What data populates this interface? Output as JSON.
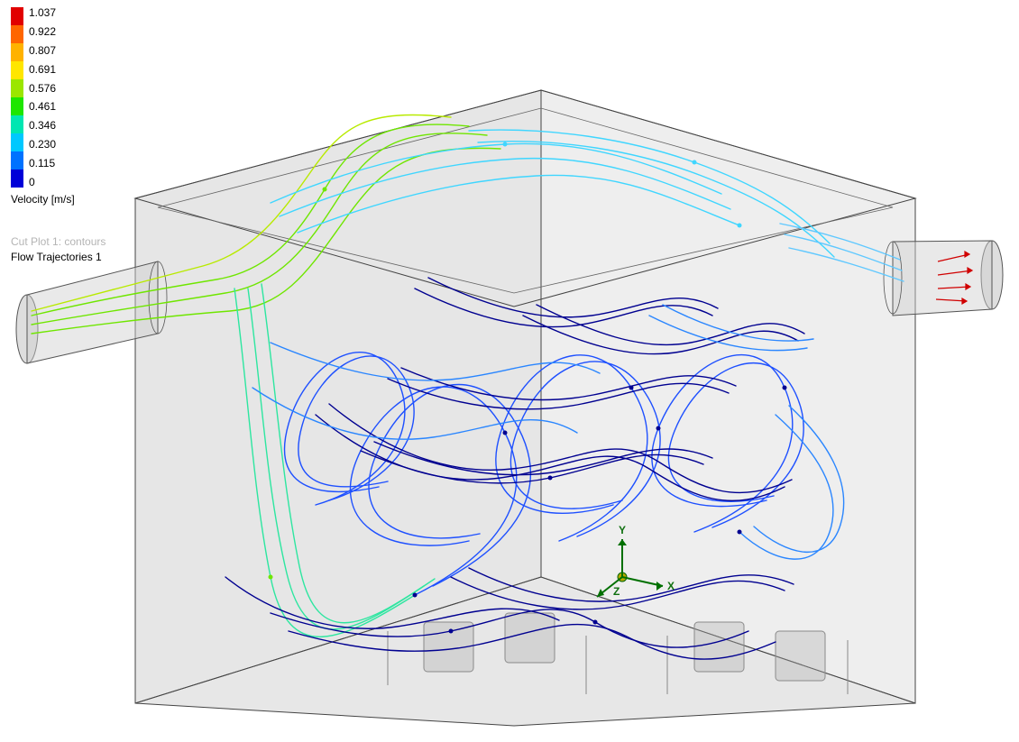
{
  "legend": {
    "title": "Velocity [m/s]",
    "ticks": [
      "1.037",
      "0.922",
      "0.807",
      "0.691",
      "0.576",
      "0.461",
      "0.346",
      "0.230",
      "0.115",
      "0"
    ],
    "colors": [
      "#e10000",
      "#ff6600",
      "#ffb200",
      "#ffe600",
      "#9be600",
      "#1ee600",
      "#00e6b2",
      "#00c8ff",
      "#0072ff",
      "#0000d8"
    ]
  },
  "layers": {
    "inactive": "Cut Plot 1: contours",
    "active": "Flow Trajectories 1"
  },
  "triad": {
    "x": "X",
    "y": "Y",
    "z": "Z"
  }
}
